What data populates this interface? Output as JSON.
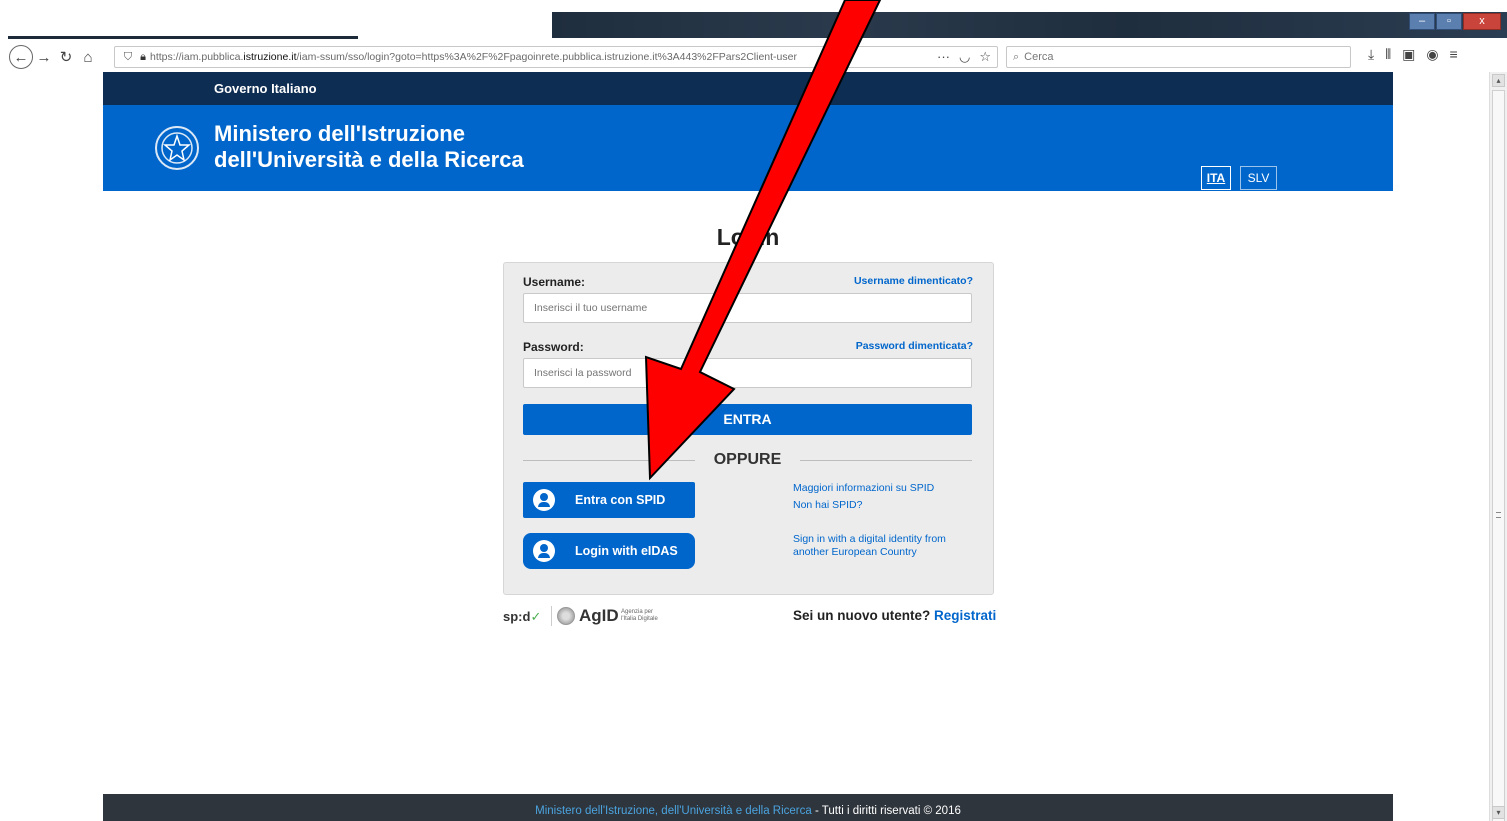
{
  "browser": {
    "url_prefix": "https://iam.pubblica.",
    "url_domain": "istruzione.it",
    "url_path": "/iam-ssum/sso/login?goto=https%3A%2F%2Fpagoinrete.pubblica.istruzione.it%3A443%2FPars2Client-user",
    "search_placeholder": "Cerca",
    "more_icon_text": "···",
    "icons": [
      "back-icon",
      "forward-icon",
      "reload-icon",
      "home-icon",
      "shield-icon",
      "lock-icon",
      "pocket-icon",
      "star-icon",
      "search-icon",
      "download-icon",
      "library-icon",
      "sidebar-icon",
      "account-icon",
      "menu-icon"
    ]
  },
  "site": {
    "gov_label": "Governo Italiano",
    "ministry_line1": "Ministero dell'Istruzione",
    "ministry_line2": "dell'Università e della Ricerca",
    "lang_ita": "ITA",
    "lang_slv": "SLV"
  },
  "login": {
    "title": "Login",
    "username_label": "Username:",
    "username_forgot": "Username dimenticato?",
    "username_placeholder": "Inserisci il tuo username",
    "password_label": "Password:",
    "password_forgot": "Password dimenticata?",
    "password_placeholder": "Inserisci la password",
    "submit_label": "ENTRA",
    "or_label": "OPPURE",
    "spid_button": "Entra con SPID",
    "spid_info": "Maggiori informazioni su SPID",
    "spid_none": "Non hai SPID?",
    "eidas_button": "Login with eIDAS",
    "eidas_info": "Sign in with a digital identity from another European Country"
  },
  "logos": {
    "spid": "sp:d",
    "spid_check": "✓",
    "agid": "AgID",
    "agid_sub": "Agenzia per l'Italia Digitale"
  },
  "register": {
    "prompt": "Sei un nuovo utente?",
    "link": "Registrati"
  },
  "footer": {
    "link": "Ministero dell'Istruzione, dell'Università e della Ricerca",
    "rights": " - Tutti i diritti riservati © 2016"
  },
  "colors": {
    "brand_blue": "#0066cc",
    "gov_bar": "#0e2d52",
    "footer": "#2f353c",
    "annotation_arrow": "#ff0000"
  }
}
